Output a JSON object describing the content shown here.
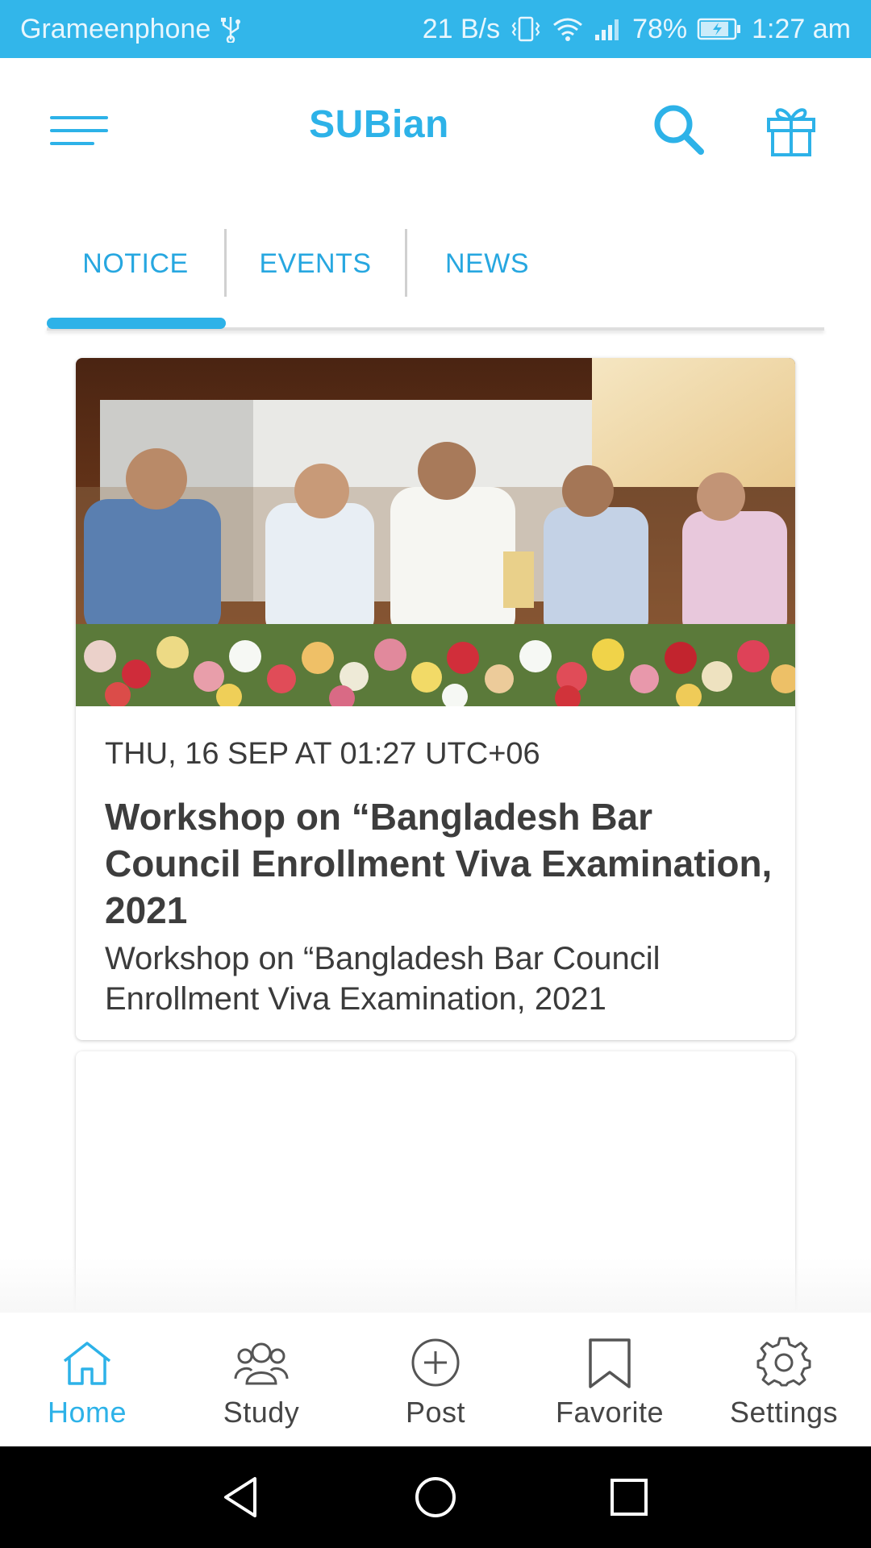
{
  "status_bar": {
    "carrier": "Grameenphone",
    "speed": "21 B/s",
    "battery": "78%",
    "time": "1:27 am",
    "icons": [
      "usb-icon",
      "vibrate-icon",
      "wifi-icon",
      "signal-icon",
      "battery-charging-icon"
    ]
  },
  "app_bar": {
    "title": "SUBian",
    "icons": [
      "menu-icon",
      "search-icon",
      "gift-icon"
    ],
    "accent_color": "#2db2e8"
  },
  "tabs": [
    {
      "label": "NOTICE",
      "active": true
    },
    {
      "label": "EVENTS",
      "active": false
    },
    {
      "label": "NEWS",
      "active": false
    }
  ],
  "feed": [
    {
      "image": "event-photo",
      "date": "THU, 16 SEP AT 01:27 UTC+06",
      "title": "Workshop on “Bangladesh Bar Council Enrollment Viva Examination, 2021",
      "body": "Workshop on “Bangladesh Bar Council Enrollment Viva Examination, 2021"
    }
  ],
  "bottom_nav": [
    {
      "label": "Home",
      "icon": "home-icon",
      "active": true
    },
    {
      "label": "Study",
      "icon": "study-group-icon",
      "active": false
    },
    {
      "label": "Post",
      "icon": "add-circle-icon",
      "active": false
    },
    {
      "label": "Favorite",
      "icon": "bookmark-icon",
      "active": false
    },
    {
      "label": "Settings",
      "icon": "gear-icon",
      "active": false
    }
  ],
  "system_nav": [
    "back-icon",
    "home-circle-icon",
    "recents-icon"
  ]
}
